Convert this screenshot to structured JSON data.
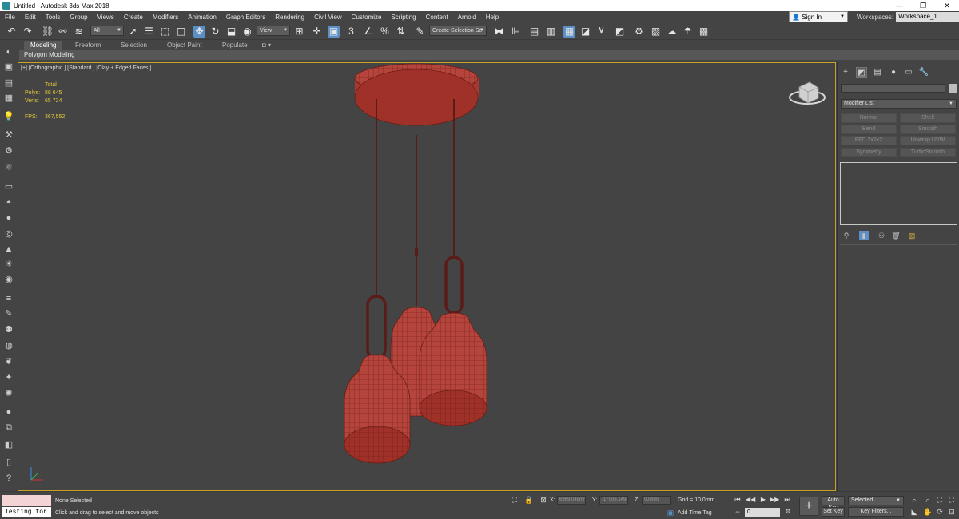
{
  "window": {
    "title": "Untitled - Autodesk 3ds Max 2018",
    "controls": [
      "—",
      "❐",
      "✕"
    ]
  },
  "menu": [
    "File",
    "Edit",
    "Tools",
    "Group",
    "Views",
    "Create",
    "Modifiers",
    "Animation",
    "Graph Editors",
    "Rendering",
    "Civil View",
    "Customize",
    "Scripting",
    "Content",
    "Arnold",
    "Help"
  ],
  "account": {
    "sign_in": "Sign In",
    "workspaces_label": "Workspaces:",
    "workspace": "Workspace_1"
  },
  "toolbar": {
    "selection_filter": "All",
    "reference_coord": "View",
    "named_selection": "Create Selection Se"
  },
  "ribbon": {
    "tabs": [
      "Modeling",
      "Freeform",
      "Selection",
      "Object Paint",
      "Populate"
    ],
    "active_tab": "Modeling",
    "sub_label": "Polygon Modeling"
  },
  "viewport": {
    "label": "[+] [Orthographic ] [Standard ] [Clay + Edged Faces ]",
    "stats": {
      "header": "Total",
      "polys_label": "Polys:",
      "polys": "88 645",
      "verts_label": "Verts:",
      "verts": "65 724",
      "fps_label": "FPS:",
      "fps": "367,552"
    },
    "mesh_color": "#b5453c",
    "border_color": "#c9a226"
  },
  "command_panel": {
    "modifier_list": "Modifier List",
    "modifiers": [
      "Normal",
      "Shell",
      "Bend",
      "Smooth",
      "FFD 2x2x2",
      "Unwrap UVW",
      "Symmetry",
      "TurboSmooth"
    ]
  },
  "status": {
    "script_listener": "Testing for ...",
    "selection": "None Selected",
    "prompt": "Click and drag to select and move objects",
    "x_label": "X:",
    "x_value": "6969,048mm",
    "y_label": "Y:",
    "y_value": "-17006,149mm",
    "z_label": "Z:",
    "z_value": "0,0mm",
    "grid": "Grid = 10,0mm",
    "add_time_tag": "Add Time Tag",
    "frame": "0",
    "auto_key": "Auto Key",
    "set_key": "Set Key",
    "key_mode": "Selected",
    "key_filters": "Key Filters..."
  }
}
